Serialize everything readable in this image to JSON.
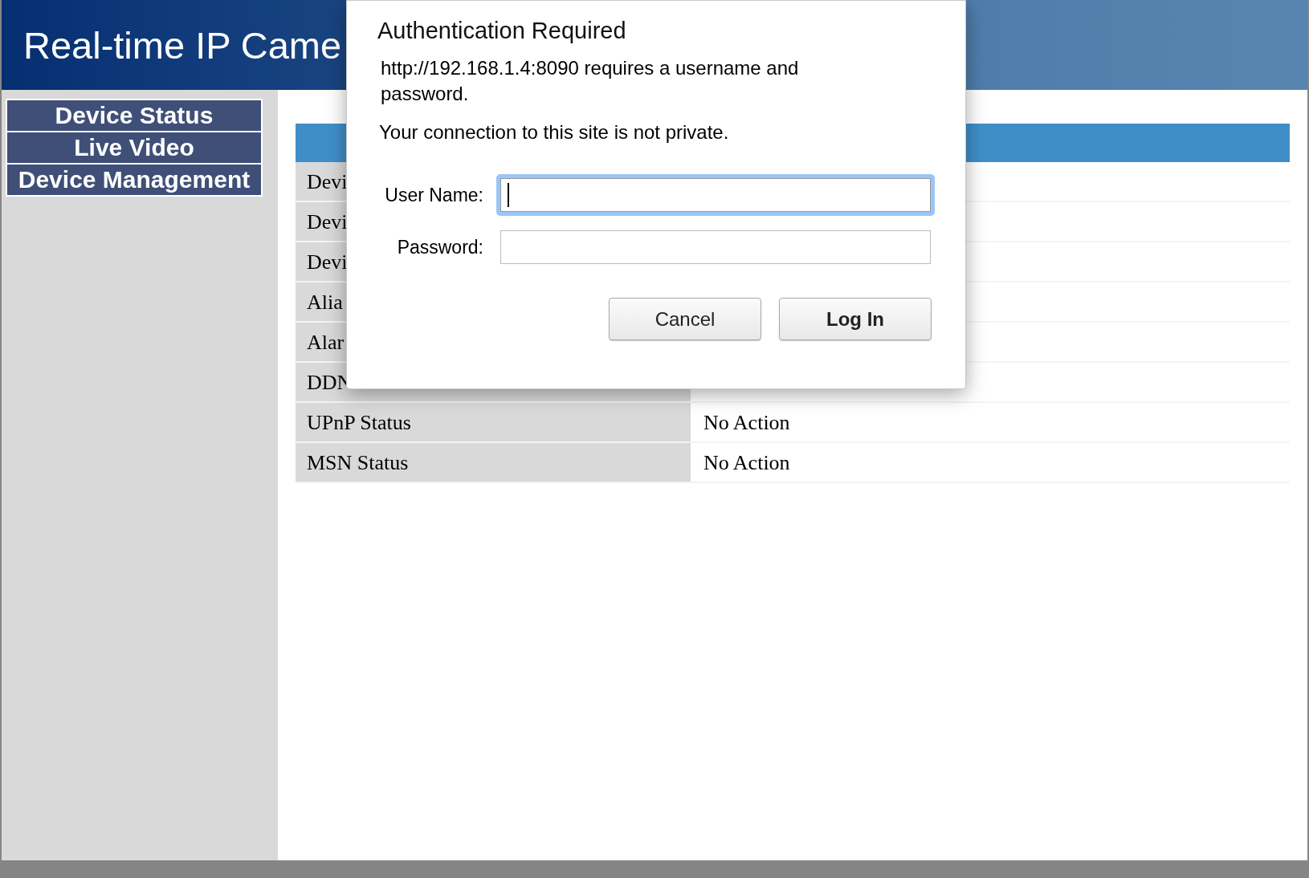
{
  "header": {
    "title": "Real-time IP Came"
  },
  "sidebar": {
    "items": [
      {
        "label": "Device Status"
      },
      {
        "label": "Live Video"
      },
      {
        "label": "Device Management"
      }
    ]
  },
  "table": {
    "rows": [
      {
        "label": "Devi"
      },
      {
        "label": "Devi"
      },
      {
        "label": "Devi"
      },
      {
        "label": "Alia"
      },
      {
        "label": "Alar"
      },
      {
        "label": "DDN"
      },
      {
        "label": "UPnP Status",
        "value": "No Action"
      },
      {
        "label": "MSN Status",
        "value": "No Action"
      }
    ]
  },
  "dialog": {
    "title": "Authentication Required",
    "message": "http://192.168.1.4:8090 requires a username and password.",
    "warning": "Your connection to this site is not private.",
    "fields": [
      {
        "label": "User Name:",
        "focused": true
      },
      {
        "label": "Password:",
        "focused": false
      }
    ],
    "buttons": [
      {
        "label": "Cancel",
        "default": false
      },
      {
        "label": "Log In",
        "default": true
      }
    ]
  }
}
